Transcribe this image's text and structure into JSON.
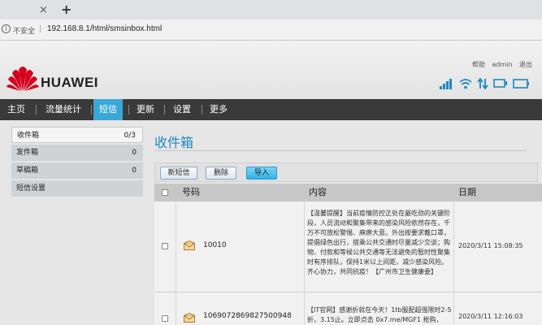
{
  "browser": {
    "tab_close_glyph": "×",
    "new_tab_glyph": "+",
    "security_label": "不安全",
    "separator": "|",
    "url": "192.168.8.1/html/smsinbox.html"
  },
  "header": {
    "links": [
      "帮助",
      "admin",
      "退出"
    ],
    "brand": "HUAWEI",
    "brand_color": "#d6001c",
    "status_icons": [
      "signal-icon",
      "wifi-icon",
      "data-transfer-icon",
      "monitor-icon",
      "battery-icon"
    ]
  },
  "nav": {
    "items": [
      "主页",
      "流量统计",
      "短信",
      "更新",
      "设置",
      "更多"
    ],
    "active_index": 2,
    "active_color": "#38a8d8"
  },
  "sidebar": {
    "items": [
      {
        "label": "收件箱",
        "count": "0/3",
        "active": true
      },
      {
        "label": "发件箱",
        "count": "0"
      },
      {
        "label": "草稿箱",
        "count": "0"
      },
      {
        "label": "短信设置",
        "count": ""
      }
    ]
  },
  "main": {
    "title": "收件箱",
    "title_color": "#1a89c4",
    "buttons": {
      "new": "新短信",
      "delete": "删除",
      "import": "导入"
    },
    "columns": {
      "number": "号码",
      "content": "内容",
      "date": "日期"
    },
    "messages": [
      {
        "number": "10010",
        "content": "【温馨提醒】当前疫情防控正处在最吃劲的关键阶段，人员流动和聚集带来的感染风险依然存在，千万不可放松警惕、麻痹大意。外出按要求戴口罩，提倡绿色出行，搭乘公共交通时尽量减少交谈；购物、付款和等候公共交通等无法避免的暂时性聚集时有序排队，保持1米以上间距，减少感染风险。齐心协力，共同抗疫！【广州市卫生健康委】",
        "date": "2020/3/11 15:08:35"
      },
      {
        "number": "1069072869827500948",
        "content": "【IT官网】感谢折就在今天！1tb服配超强限时2-5折，3.15止。立即点击 0x7.me/MGF1 抢购，",
        "date": "2020/3/11 12:16:03"
      }
    ]
  }
}
